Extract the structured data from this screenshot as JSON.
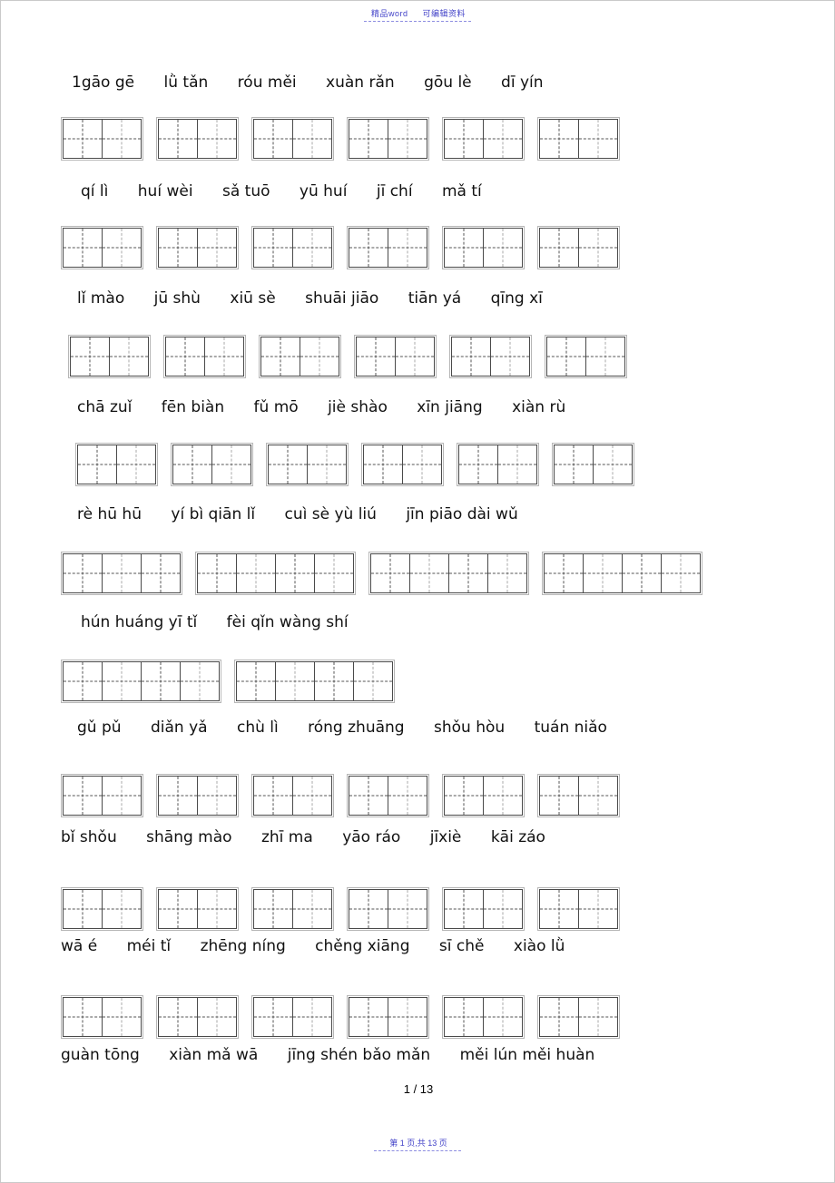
{
  "document": {
    "header_watermark_left": "精品word",
    "header_watermark_right": "可编辑资料",
    "page_number": "1 / 13",
    "footer_watermark": "第 1 页,共 13 页"
  },
  "worksheet": {
    "type": "pinyin-writing-practice",
    "grid_style": "tianzige",
    "lines": [
      {
        "id": "line-1",
        "pinyin": "1gāo gē      lǜ tǎn      róu měi      xuàn rǎn      gōu lè      dī yín",
        "grid": {
          "groups": [
            2,
            2,
            2,
            2,
            2,
            2
          ],
          "cells_total": 12
        }
      },
      {
        "id": "line-2",
        "pinyin": "qí lì      huí wèi      sǎ tuō      yū huí      jī chí      mǎ tí",
        "grid": {
          "groups": [
            2,
            2,
            2,
            2,
            2,
            2
          ],
          "cells_total": 12
        }
      },
      {
        "id": "line-3",
        "pinyin": "lǐ mào      jū shù      xiū sè      shuāi jiāo      tiān yá      qīng xī",
        "grid": {
          "groups": [
            2,
            2,
            2,
            2,
            2,
            2
          ],
          "cells_total": 12
        }
      },
      {
        "id": "line-4",
        "pinyin": "chā zuǐ      fēn biàn      fǔ mō      jiè shào      xīn jiāng      xiàn rù",
        "grid": {
          "groups": [
            2,
            2,
            2,
            2,
            2,
            2
          ],
          "cells_total": 12
        }
      },
      {
        "id": "line-5",
        "pinyin": "rè hū hū      yí bì qiān lǐ      cuì sè yù liú      jīn piāo dài wǔ",
        "grid": {
          "groups": [
            3,
            4,
            4,
            4
          ],
          "cells_total": 15
        }
      },
      {
        "id": "line-6",
        "pinyin": "hún huáng yī tǐ      fèi qǐn wàng shí",
        "grid": {
          "groups": [
            4,
            4
          ],
          "cells_total": 8
        }
      },
      {
        "id": "line-7",
        "pinyin": "gǔ pǔ      diǎn yǎ      chù lì      róng zhuāng      shǒu hòu      tuán niǎo",
        "grid": {
          "groups": [
            2,
            2,
            2,
            2,
            2,
            2
          ],
          "cells_total": 12
        }
      },
      {
        "id": "line-8",
        "pinyin": "bǐ shǒu      shāng mào      zhī ma      yāo ráo      jīxiè      kāi záo",
        "grid": {
          "groups": [
            2,
            2,
            2,
            2,
            2,
            2
          ],
          "cells_total": 12
        }
      },
      {
        "id": "line-9",
        "pinyin": "wā é      méi tǐ      zhēng níng      chěng xiāng      sī chě      xiào lǜ",
        "grid": {
          "groups": [
            2,
            2,
            2,
            2,
            2,
            2
          ],
          "cells_total": 12
        }
      },
      {
        "id": "line-10",
        "pinyin": "guàn tōng      xiàn mǎ wā      jīng shén bǎo mǎn      měi lún měi huàn",
        "grid": {
          "groups": [
            2,
            2,
            2,
            2,
            2,
            2
          ],
          "cells_total": 12
        }
      }
    ]
  }
}
